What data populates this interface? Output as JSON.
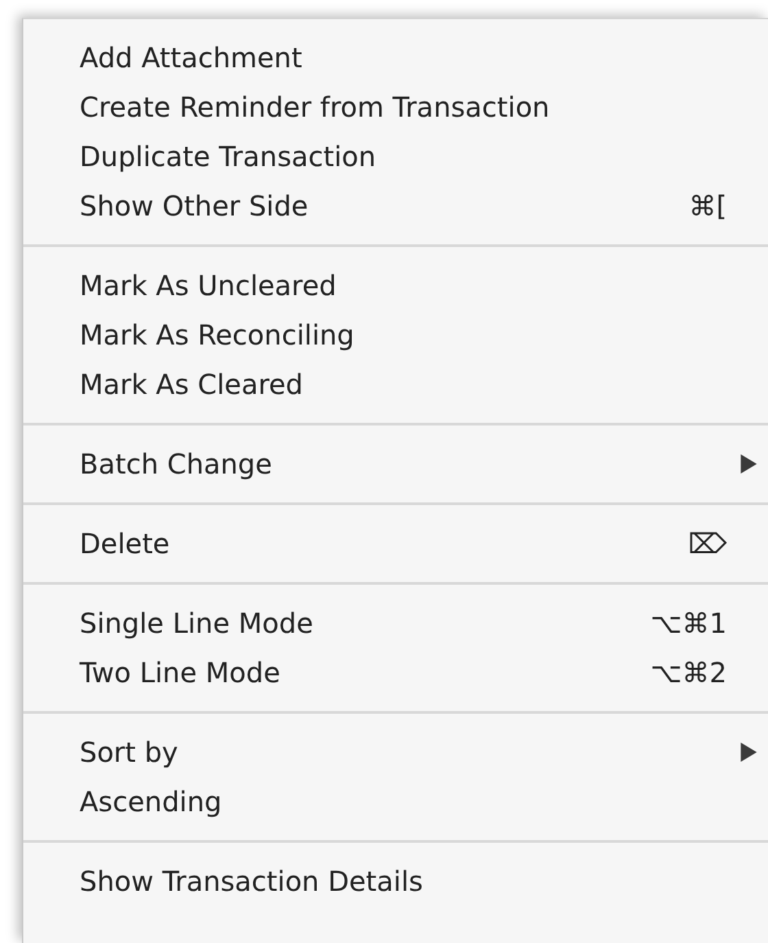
{
  "menu": {
    "sections": [
      {
        "items": [
          {
            "label": "Add Attachment",
            "kind": "action"
          },
          {
            "label": "Create Reminder from Transaction",
            "kind": "action"
          },
          {
            "label": "Duplicate Transaction",
            "kind": "action"
          },
          {
            "label": "Show Other Side",
            "kind": "action",
            "shortcut": "⌘["
          }
        ]
      },
      {
        "items": [
          {
            "label": "Mark As Uncleared",
            "kind": "action"
          },
          {
            "label": "Mark As Reconciling",
            "kind": "action"
          },
          {
            "label": "Mark As Cleared",
            "kind": "action"
          }
        ]
      },
      {
        "items": [
          {
            "label": "Batch Change",
            "kind": "submenu"
          }
        ]
      },
      {
        "items": [
          {
            "label": "Delete",
            "kind": "action",
            "shortcut": "⌦"
          }
        ]
      },
      {
        "items": [
          {
            "label": "Single Line Mode",
            "kind": "action",
            "shortcut": "⌥⌘1"
          },
          {
            "label": "Two Line Mode",
            "kind": "action",
            "shortcut": "⌥⌘2"
          }
        ]
      },
      {
        "items": [
          {
            "label": "Sort by",
            "kind": "submenu"
          },
          {
            "label": "Ascending",
            "kind": "action"
          }
        ]
      },
      {
        "items": [
          {
            "label": "Show Transaction Details",
            "kind": "action"
          }
        ]
      }
    ]
  }
}
